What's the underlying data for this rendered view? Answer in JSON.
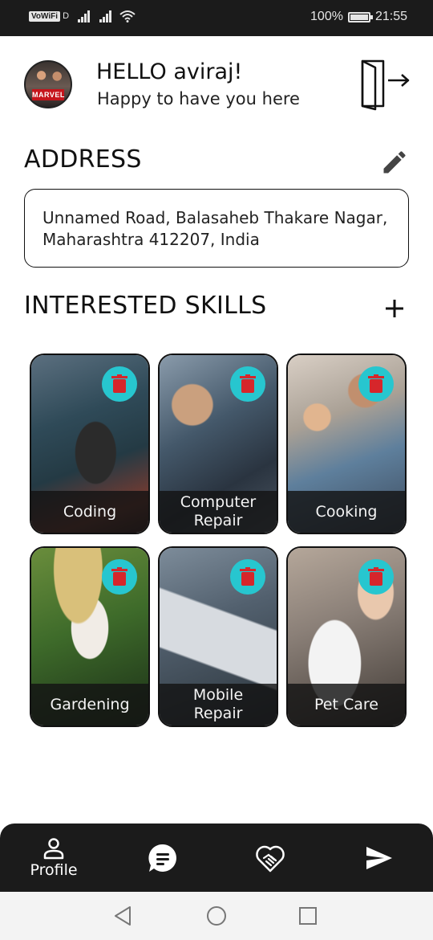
{
  "status_bar": {
    "vowifi": "VoWiFi",
    "vowifi_sub": "D",
    "battery": "100%",
    "time": "21:55"
  },
  "header": {
    "avatar_badge": "MARVEL",
    "greeting": "HELLO aviraj!",
    "subtitle": "Happy to have you here",
    "logout_icon": "logout-door-icon"
  },
  "address": {
    "title": "ADDRESS",
    "text": "Unnamed Road, Balasaheb Thakare Nagar, Maharashtra 412207, India",
    "edit_icon": "pencil-icon"
  },
  "skills": {
    "title": "INTERESTED SKILLS",
    "add_icon": "plus-icon",
    "delete_icon": "trash-icon",
    "accent": "#27c6cf",
    "delete_color": "#d6262b",
    "items": [
      {
        "label": "Coding"
      },
      {
        "label": "Computer Repair"
      },
      {
        "label": "Cooking"
      },
      {
        "label": "Gardening"
      },
      {
        "label": "Mobile Repair"
      },
      {
        "label": "Pet Care"
      }
    ]
  },
  "bottom_nav": {
    "items": [
      {
        "label": "Profile",
        "icon": "person-icon"
      },
      {
        "label": "",
        "icon": "chat-bubble-icon"
      },
      {
        "label": "",
        "icon": "handshake-heart-icon"
      },
      {
        "label": "",
        "icon": "send-icon"
      }
    ]
  },
  "system_nav": {
    "back": "back-triangle-icon",
    "home": "home-circle-icon",
    "recents": "recents-square-icon"
  }
}
